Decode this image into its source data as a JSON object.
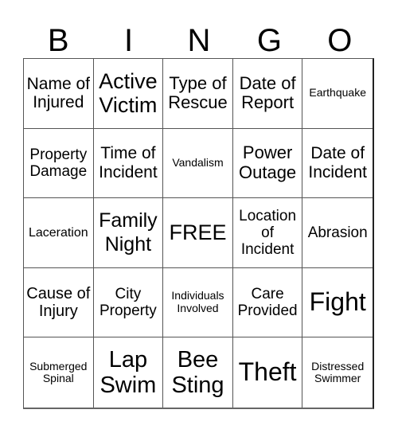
{
  "header": {
    "letters": [
      "B",
      "I",
      "N",
      "G",
      "O"
    ]
  },
  "board": {
    "rows": [
      [
        "Name of Injured",
        "Active Victim",
        "Type of Rescue",
        "Date of Report",
        "Earthquake"
      ],
      [
        "Property Damage",
        "Time of Incident",
        "Vandalism",
        "Power Outage",
        "Date of Incident"
      ],
      [
        "Laceration",
        "Family Night",
        "FREE",
        "Location of Incident",
        "Abrasion"
      ],
      [
        "Cause of Injury",
        "City Property",
        "Individuals Involved",
        "Care Provided",
        "Fight"
      ],
      [
        "Submerged Spinal",
        "Lap Swim",
        "Bee Sting",
        "Theft",
        "Distressed Swimmer"
      ]
    ]
  }
}
